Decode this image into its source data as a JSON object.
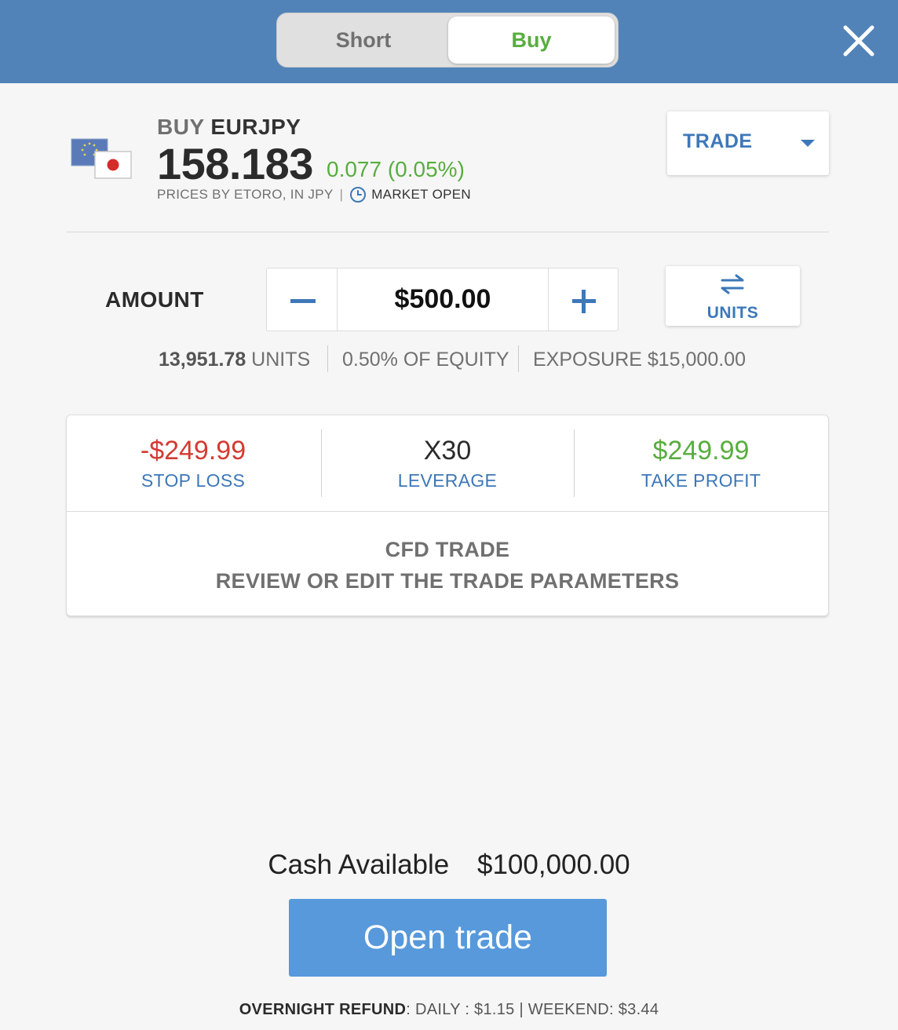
{
  "header": {
    "toggle": {
      "short_label": "Short",
      "buy_label": "Buy",
      "selected": "Buy"
    },
    "close_icon": "close-icon",
    "colors": {
      "bar": "#5183b8",
      "buy_green": "#58ad3f"
    }
  },
  "instrument": {
    "action": "BUY",
    "symbol": "EURJPY",
    "price": "158.183",
    "change": "0.077 (0.05%)",
    "prices_by": "PRICES BY ETORO, IN JPY",
    "separator": "|",
    "market_status": "MARKET OPEN",
    "flags_icon": "eur-jpy-flags-icon"
  },
  "order_type": {
    "label": "TRADE",
    "icon": "chevron-down-icon"
  },
  "amount": {
    "label": "AMOUNT",
    "value": "$500.00",
    "minus_icon": "minus-icon",
    "plus_icon": "plus-icon",
    "units_button_label": "UNITS",
    "units_value": "13,951.78",
    "units_suffix": "UNITS",
    "equity": "0.50% OF EQUITY",
    "exposure": "EXPOSURE $15,000.00"
  },
  "params": {
    "stop_loss": {
      "value": "-$249.99",
      "label": "STOP LOSS"
    },
    "leverage": {
      "value": "X30",
      "label": "LEVERAGE"
    },
    "take_profit": {
      "value": "$249.99",
      "label": "TAKE PROFIT"
    },
    "cfd_title": "CFD TRADE",
    "cfd_subtitle": "REVIEW OR EDIT THE TRADE PARAMETERS"
  },
  "footer": {
    "cash_label": "Cash Available",
    "cash_value": "$100,000.00",
    "open_button": "Open trade",
    "overnight_label": "OVERNIGHT REFUND",
    "overnight_rest": ": DAILY : $1.15 | WEEKEND: $3.44"
  }
}
